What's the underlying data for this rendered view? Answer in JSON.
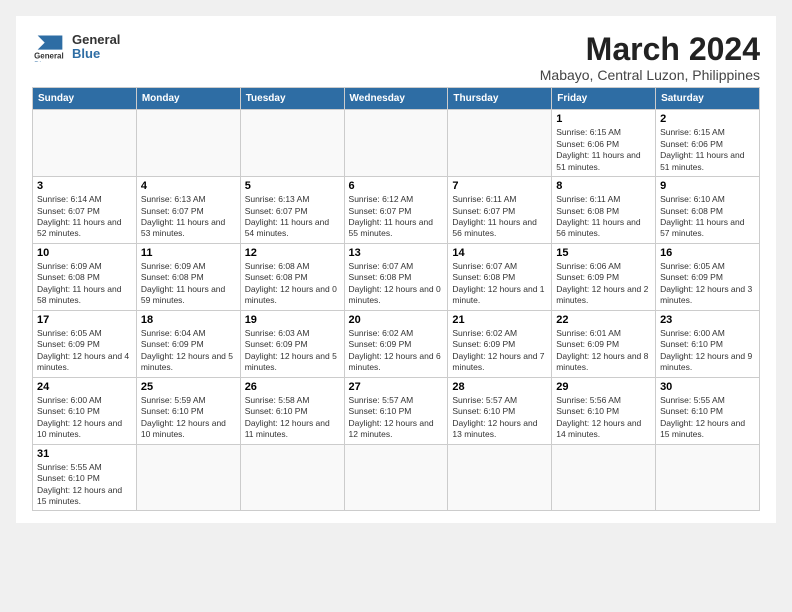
{
  "logo": {
    "line1": "General",
    "line2": "Blue"
  },
  "title": "March 2024",
  "subtitle": "Mabayo, Central Luzon, Philippines",
  "days_of_week": [
    "Sunday",
    "Monday",
    "Tuesday",
    "Wednesday",
    "Thursday",
    "Friday",
    "Saturday"
  ],
  "weeks": [
    [
      {
        "day": null
      },
      {
        "day": null
      },
      {
        "day": null
      },
      {
        "day": null
      },
      {
        "day": null
      },
      {
        "day": "1",
        "info": "Sunrise: 6:15 AM\nSunset: 6:06 PM\nDaylight: 11 hours and 51 minutes."
      },
      {
        "day": "2",
        "info": "Sunrise: 6:15 AM\nSunset: 6:06 PM\nDaylight: 11 hours and 51 minutes."
      }
    ],
    [
      {
        "day": "3",
        "info": "Sunrise: 6:14 AM\nSunset: 6:07 PM\nDaylight: 11 hours and 52 minutes."
      },
      {
        "day": "4",
        "info": "Sunrise: 6:13 AM\nSunset: 6:07 PM\nDaylight: 11 hours and 53 minutes."
      },
      {
        "day": "5",
        "info": "Sunrise: 6:13 AM\nSunset: 6:07 PM\nDaylight: 11 hours and 54 minutes."
      },
      {
        "day": "6",
        "info": "Sunrise: 6:12 AM\nSunset: 6:07 PM\nDaylight: 11 hours and 55 minutes."
      },
      {
        "day": "7",
        "info": "Sunrise: 6:11 AM\nSunset: 6:07 PM\nDaylight: 11 hours and 56 minutes."
      },
      {
        "day": "8",
        "info": "Sunrise: 6:11 AM\nSunset: 6:08 PM\nDaylight: 11 hours and 56 minutes."
      },
      {
        "day": "9",
        "info": "Sunrise: 6:10 AM\nSunset: 6:08 PM\nDaylight: 11 hours and 57 minutes."
      }
    ],
    [
      {
        "day": "10",
        "info": "Sunrise: 6:09 AM\nSunset: 6:08 PM\nDaylight: 11 hours and 58 minutes."
      },
      {
        "day": "11",
        "info": "Sunrise: 6:09 AM\nSunset: 6:08 PM\nDaylight: 11 hours and 59 minutes."
      },
      {
        "day": "12",
        "info": "Sunrise: 6:08 AM\nSunset: 6:08 PM\nDaylight: 12 hours and 0 minutes."
      },
      {
        "day": "13",
        "info": "Sunrise: 6:07 AM\nSunset: 6:08 PM\nDaylight: 12 hours and 0 minutes."
      },
      {
        "day": "14",
        "info": "Sunrise: 6:07 AM\nSunset: 6:08 PM\nDaylight: 12 hours and 1 minute."
      },
      {
        "day": "15",
        "info": "Sunrise: 6:06 AM\nSunset: 6:09 PM\nDaylight: 12 hours and 2 minutes."
      },
      {
        "day": "16",
        "info": "Sunrise: 6:05 AM\nSunset: 6:09 PM\nDaylight: 12 hours and 3 minutes."
      }
    ],
    [
      {
        "day": "17",
        "info": "Sunrise: 6:05 AM\nSunset: 6:09 PM\nDaylight: 12 hours and 4 minutes."
      },
      {
        "day": "18",
        "info": "Sunrise: 6:04 AM\nSunset: 6:09 PM\nDaylight: 12 hours and 5 minutes."
      },
      {
        "day": "19",
        "info": "Sunrise: 6:03 AM\nSunset: 6:09 PM\nDaylight: 12 hours and 5 minutes."
      },
      {
        "day": "20",
        "info": "Sunrise: 6:02 AM\nSunset: 6:09 PM\nDaylight: 12 hours and 6 minutes."
      },
      {
        "day": "21",
        "info": "Sunrise: 6:02 AM\nSunset: 6:09 PM\nDaylight: 12 hours and 7 minutes."
      },
      {
        "day": "22",
        "info": "Sunrise: 6:01 AM\nSunset: 6:09 PM\nDaylight: 12 hours and 8 minutes."
      },
      {
        "day": "23",
        "info": "Sunrise: 6:00 AM\nSunset: 6:10 PM\nDaylight: 12 hours and 9 minutes."
      }
    ],
    [
      {
        "day": "24",
        "info": "Sunrise: 6:00 AM\nSunset: 6:10 PM\nDaylight: 12 hours and 10 minutes."
      },
      {
        "day": "25",
        "info": "Sunrise: 5:59 AM\nSunset: 6:10 PM\nDaylight: 12 hours and 10 minutes."
      },
      {
        "day": "26",
        "info": "Sunrise: 5:58 AM\nSunset: 6:10 PM\nDaylight: 12 hours and 11 minutes."
      },
      {
        "day": "27",
        "info": "Sunrise: 5:57 AM\nSunset: 6:10 PM\nDaylight: 12 hours and 12 minutes."
      },
      {
        "day": "28",
        "info": "Sunrise: 5:57 AM\nSunset: 6:10 PM\nDaylight: 12 hours and 13 minutes."
      },
      {
        "day": "29",
        "info": "Sunrise: 5:56 AM\nSunset: 6:10 PM\nDaylight: 12 hours and 14 minutes."
      },
      {
        "day": "30",
        "info": "Sunrise: 5:55 AM\nSunset: 6:10 PM\nDaylight: 12 hours and 15 minutes."
      }
    ],
    [
      {
        "day": "31",
        "info": "Sunrise: 5:55 AM\nSunset: 6:10 PM\nDaylight: 12 hours and 15 minutes."
      },
      {
        "day": null
      },
      {
        "day": null
      },
      {
        "day": null
      },
      {
        "day": null
      },
      {
        "day": null
      },
      {
        "day": null
      }
    ]
  ]
}
